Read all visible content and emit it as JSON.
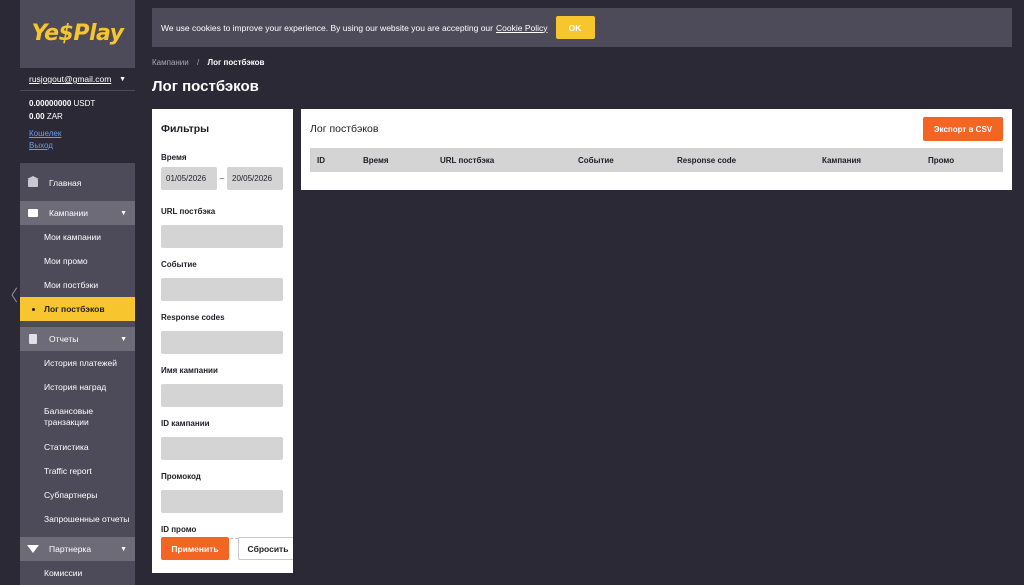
{
  "logo": {
    "text_prefix": "Y",
    "text_main": "e$Play"
  },
  "account": {
    "email": "rusjogout@gmail.com",
    "balance_usdt": "0.00000000",
    "currency_usdt": "USDT",
    "balance_zar": "0.00",
    "currency_zar": "ZAR",
    "wallet_link": "Кошелек",
    "logout_link": "Выход"
  },
  "nav": {
    "home": "Главная",
    "campaigns": {
      "label": "Кампании",
      "items": [
        "Мои кампании",
        "Мои промо",
        "Мои постбэки",
        "Лог постбэков"
      ]
    },
    "reports": {
      "label": "Отчеты",
      "items": [
        "История платежей",
        "История наград",
        "Балансовые транзакции",
        "Статистика",
        "Traffic report",
        "Субпартнеры",
        "Запрошенные отчеты"
      ]
    },
    "partnership": {
      "label": "Партнерка",
      "items": [
        "Комиссии"
      ]
    }
  },
  "cookie": {
    "text": "We use cookies to improve your experience. By using our website you are accepting our",
    "link": "Cookie Policy",
    "ok": "OK"
  },
  "breadcrumb": {
    "parent": "Кампании",
    "separator": "/",
    "current": "Лог постбэков"
  },
  "page_title": "Лог постбэков",
  "filters": {
    "title": "Фильтры",
    "time_label": "Время",
    "date_from": "01/05/2026",
    "date_sep": "–",
    "date_to": "20/05/2026",
    "url_label": "URL постбэка",
    "event_label": "Событие",
    "response_label": "Response codes",
    "campaign_name_label": "Имя кампании",
    "campaign_id_label": "ID кампании",
    "promocode_label": "Промокод",
    "promo_id_label": "ID промо",
    "apply": "Применить",
    "reset": "Сбросить"
  },
  "log": {
    "title": "Лог постбэков",
    "export": "Экспорт в CSV",
    "columns": [
      "ID",
      "Время",
      "URL постбэка",
      "Событие",
      "Response code",
      "Кампания",
      "Промо"
    ]
  }
}
